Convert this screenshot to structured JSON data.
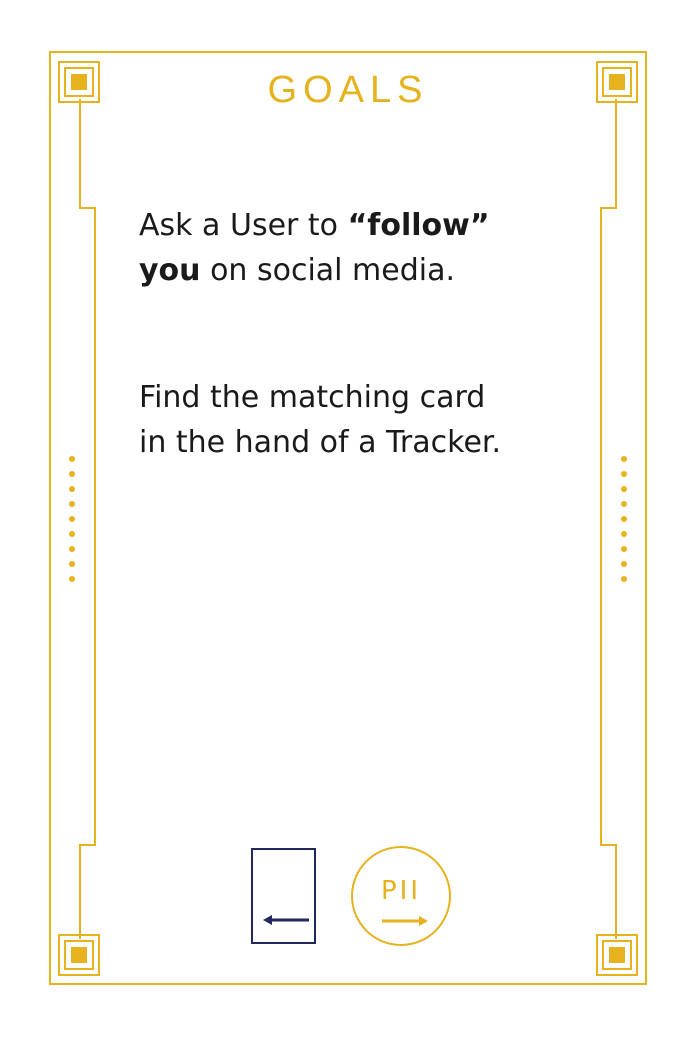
{
  "card": {
    "title": "GOALS",
    "goal_1": {
      "prefix": "Ask a User to ",
      "bold_quote": "“follow”",
      "bold_word": "you",
      "suffix": " on social media."
    },
    "goal_2": {
      "line_1": "Find the matching card",
      "line_2": "in the hand of a Tracker."
    },
    "deck_icon": "card-with-left-arrow-icon",
    "pii_icon": {
      "label": "PII",
      "icon": "pii-arrow-icon"
    }
  },
  "colors": {
    "accent_gold": "#E6B21D",
    "navy": "#22275E",
    "text": "#1a1a1a",
    "background": "#ffffff"
  }
}
